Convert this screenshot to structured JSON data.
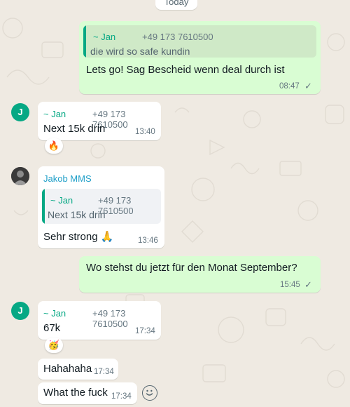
{
  "date_separator": "Today",
  "messages": [
    {
      "direction": "outgoing",
      "quote": {
        "name": "~ Jan",
        "phone": "+49 173 7610500",
        "text": "die wird so safe kundin"
      },
      "text": "Lets go! Sag Bescheid wenn deal durch ist",
      "time": "08:47",
      "status": "✓"
    },
    {
      "direction": "incoming",
      "avatar": "J",
      "sender": "~ Jan",
      "phone": "+49 173 7610500",
      "text": "Next 15k drin",
      "time": "13:40",
      "reaction": "🔥"
    },
    {
      "direction": "incoming",
      "sender": "Jakob MMS",
      "quote": {
        "name": "~ Jan",
        "phone": "+49 173 7610500",
        "text": "Next 15k drin"
      },
      "text": "Sehr strong 🙏",
      "time": "13:46"
    },
    {
      "direction": "outgoing",
      "text": "Wo stehst du jetzt für den Monat September?",
      "time": "15:45",
      "status": "✓"
    },
    {
      "direction": "incoming",
      "avatar": "J",
      "sender": "~ Jan",
      "phone": "+49 173 7610500",
      "text": "67k",
      "time": "17:34",
      "reaction": "🥳"
    },
    {
      "direction": "incoming",
      "text": "Hahahaha",
      "time": "17:34"
    },
    {
      "direction": "incoming",
      "text": "What the fuck",
      "time": "17:34"
    }
  ],
  "icons": {
    "reaction_button": "smiley-icon",
    "read_status": "check-icon"
  },
  "colors": {
    "background": "#efeae2",
    "outgoing_bubble": "#d9fdd3",
    "incoming_bubble": "#ffffff",
    "sender_green": "#06a884",
    "sender_blue": "#21a0c9"
  }
}
